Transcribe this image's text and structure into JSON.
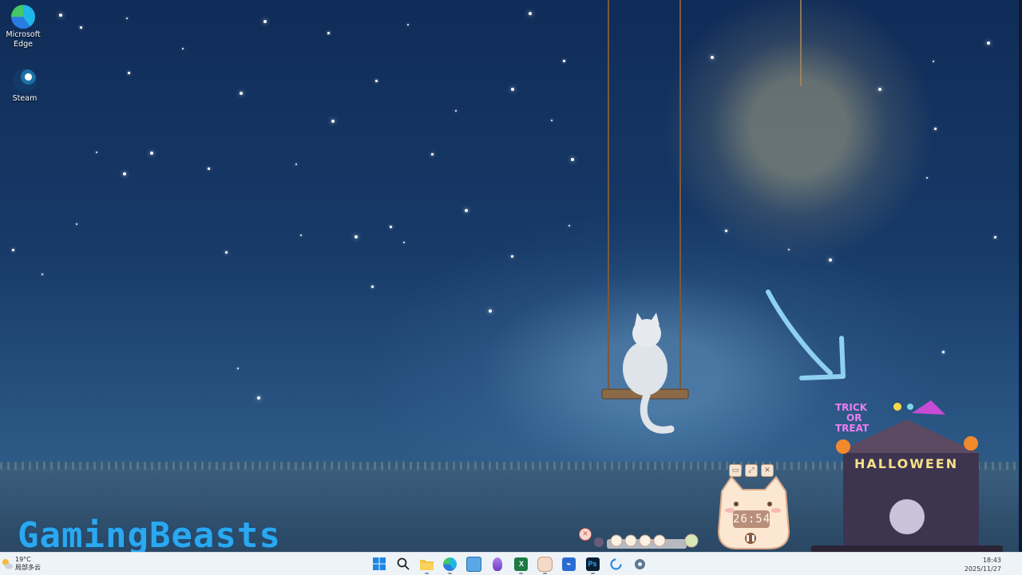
{
  "desktop": {
    "icons": [
      {
        "label_line1": "Microsoft",
        "label_line2": "Edge",
        "icon": "edge-icon"
      },
      {
        "label_line1": "Steam",
        "label_line2": "",
        "icon": "steam-icon"
      }
    ],
    "watermark": "GamingBeasts"
  },
  "widget": {
    "timer": "26:54",
    "halloween_sign": {
      "line1": "TRICK",
      "line2": "OR",
      "line3": "TREAT",
      "banner": "HALLOWEEN"
    },
    "buttons": [
      "minimize-icon",
      "expand-icon",
      "close-icon"
    ]
  },
  "taskbar": {
    "weather": {
      "temp": "19°C",
      "desc": "局部多云"
    },
    "apps": [
      {
        "name": "start",
        "icon": "windows-start-icon"
      },
      {
        "name": "search",
        "icon": "search-icon"
      },
      {
        "name": "file-explorer",
        "icon": "folder-icon"
      },
      {
        "name": "edge",
        "icon": "edge-icon"
      },
      {
        "name": "notepad",
        "icon": "notepad-icon"
      },
      {
        "name": "purple-app",
        "icon": "purple-app-icon"
      },
      {
        "name": "excel",
        "icon": "excel-icon",
        "glyph": "X"
      },
      {
        "name": "cat-app",
        "icon": "cat-app-icon"
      },
      {
        "name": "visual-studio",
        "icon": "visual-studio-icon"
      },
      {
        "name": "photoshop",
        "icon": "photoshop-icon",
        "glyph": "Ps"
      },
      {
        "name": "sync-app",
        "icon": "sync-icon"
      },
      {
        "name": "settings",
        "icon": "gear-icon"
      }
    ],
    "clock": {
      "time": "18:43",
      "date": "2025/11/27"
    }
  },
  "colors": {
    "sky_top": "#102c58",
    "moon": "#fde7a6",
    "watermark": "#2aa8f0",
    "taskbar": "#eef3f8"
  }
}
